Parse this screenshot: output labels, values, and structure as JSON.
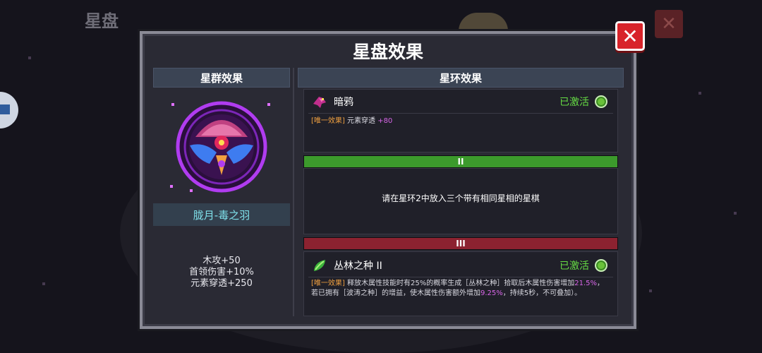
{
  "background": {
    "title": "星盘"
  },
  "dialog": {
    "title": "星盘效果",
    "close_glyph": "✕",
    "close_bg_glyph": "✕"
  },
  "cluster": {
    "header": "星群效果",
    "emblem_icon": "crow-constellation-emblem",
    "emblem_name": "胧月-毒之羽",
    "stats": [
      "木攻+50",
      "首领伤害+10%",
      "元素穿透+250"
    ]
  },
  "rings": {
    "header": "星环效果",
    "ring1": {
      "icon": "crow-icon",
      "name": "暗鸦",
      "status": "已激活",
      "effect_tag": "[唯一效果]",
      "effect_text": "元素穿透",
      "effect_value": "+80"
    },
    "ring2": {
      "bar_label": "II",
      "bar_color": "#3c9a2c",
      "message": "请在星环2中放入三个带有相同星相的星棋"
    },
    "ring3": {
      "bar_label": "III",
      "bar_color": "#8c2230",
      "icon": "leaf-icon",
      "name": "丛林之种 II",
      "status": "已激活",
      "effect_tag": "[唯一效果]",
      "effect_p1": "释放木属性技能时有25%的概率生成［丛林之种］拾取后木属性伤害增加",
      "effect_v1": "21.5%",
      "effect_p2": "，若已拥有［波涛之种］的增益，使木属性伤害额外增加",
      "effect_v2": "9.25%",
      "effect_p3": "，持续5秒，不可叠加）。"
    }
  },
  "colors": {
    "active_green": "#66dd44",
    "tag_orange": "#f0a040",
    "highlight_purple": "#d866e8",
    "name_cyan": "#7fe0ea",
    "close_red": "#d8232a"
  }
}
